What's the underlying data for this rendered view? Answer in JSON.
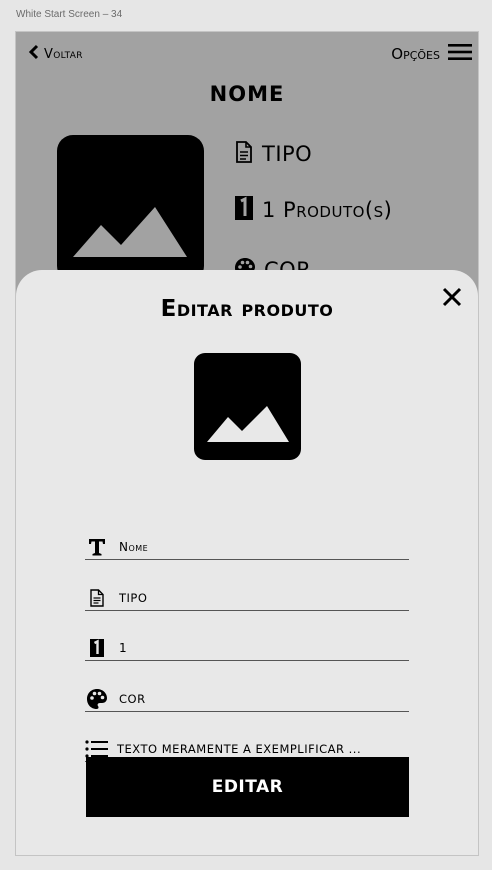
{
  "artboard": {
    "label": "White Start Screen – 34"
  },
  "topbar": {
    "back_label": "Voltar",
    "back_icon": "chevron-left-icon",
    "options_label": "Opções",
    "menu_icon": "hamburger-icon"
  },
  "product": {
    "title": "NOME",
    "image_icon": "image-placeholder-icon",
    "type_icon": "document-icon",
    "type_text": "TIPO",
    "count_icon": "number-one-icon",
    "count_text": "1 Produto(s)",
    "color_icon": "palette-icon",
    "color_text": "COR"
  },
  "modal": {
    "title": "Editar produto",
    "close_icon": "close-icon",
    "image_icon": "image-placeholder-icon",
    "fields": [
      {
        "icon": "text-format-icon",
        "value": "Nome"
      },
      {
        "icon": "document-icon",
        "value": "tipo"
      },
      {
        "icon": "number-one-icon",
        "value": "1"
      },
      {
        "icon": "palette-icon",
        "value": "cor"
      },
      {
        "icon": "list-icon",
        "value": "texto meramente a exemplificar ..."
      }
    ],
    "submit_label": "EDITAR"
  },
  "colors": {
    "page_bg": "#e6e6e6",
    "screen_dim": "#a2a2a2",
    "modal_bg": "#e8e8e8",
    "button_bg": "#000000",
    "button_text": "#ffffff"
  }
}
